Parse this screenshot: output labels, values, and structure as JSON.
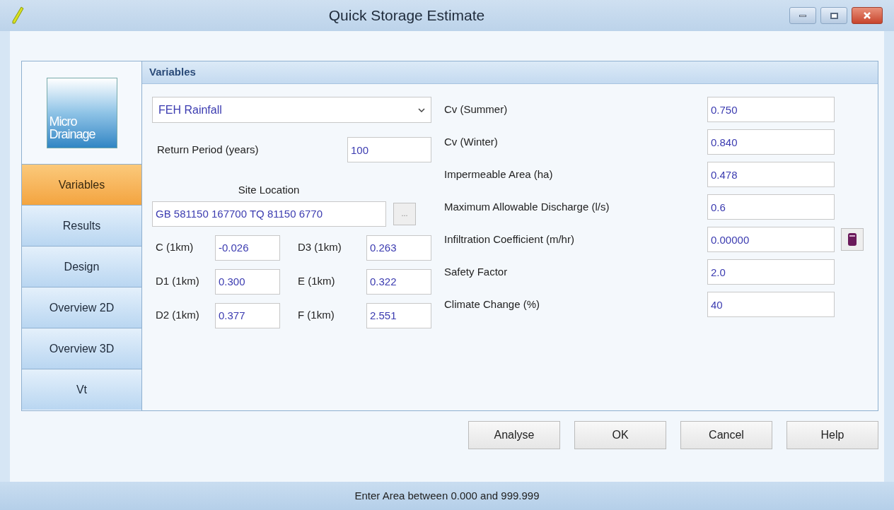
{
  "window": {
    "title": "Quick Storage Estimate"
  },
  "logo": {
    "lines": [
      "Micro",
      "Drainage"
    ]
  },
  "sidebar": {
    "items": [
      {
        "label": "Variables",
        "selected": true
      },
      {
        "label": "Results",
        "selected": false
      },
      {
        "label": "Design",
        "selected": false
      },
      {
        "label": "Overview 2D",
        "selected": false
      },
      {
        "label": "Overview 3D",
        "selected": false
      },
      {
        "label": "Vt",
        "selected": false
      }
    ]
  },
  "panel": {
    "title": "Variables",
    "rainfall_dropdown": {
      "value": "FEH Rainfall"
    },
    "return_period": {
      "label": "Return Period (years)",
      "value": "100"
    },
    "site_location": {
      "label": "Site Location",
      "value": "GB 581150 167700 TQ 81150 6770",
      "browse": "..."
    },
    "coefficients": [
      {
        "label": "C (1km)",
        "value": "-0.026"
      },
      {
        "label": "D3 (1km)",
        "value": "0.263"
      },
      {
        "label": "D1 (1km)",
        "value": "0.300"
      },
      {
        "label": "E (1km)",
        "value": "0.322"
      },
      {
        "label": "D2 (1km)",
        "value": "0.377"
      },
      {
        "label": "F (1km)",
        "value": "2.551"
      }
    ],
    "parameters": [
      {
        "label": "Cv (Summer)",
        "value": "0.750",
        "calculator": false
      },
      {
        "label": "Cv (Winter)",
        "value": "0.840",
        "calculator": false
      },
      {
        "label": "Impermeable Area (ha)",
        "value": "0.478",
        "calculator": false
      },
      {
        "label": "Maximum Allowable Discharge (l/s)",
        "value": "0.6",
        "calculator": false
      },
      {
        "label": "Infiltration Coefficient (m/hr)",
        "value": "0.00000",
        "calculator": true
      },
      {
        "label": "Safety Factor",
        "value": "2.0",
        "calculator": false
      },
      {
        "label": "Climate Change (%)",
        "value": "40",
        "calculator": false
      }
    ]
  },
  "buttons": [
    "Analyse",
    "OK",
    "Cancel",
    "Help"
  ],
  "status_bar": "Enter Area between 0.000 and 999.999"
}
